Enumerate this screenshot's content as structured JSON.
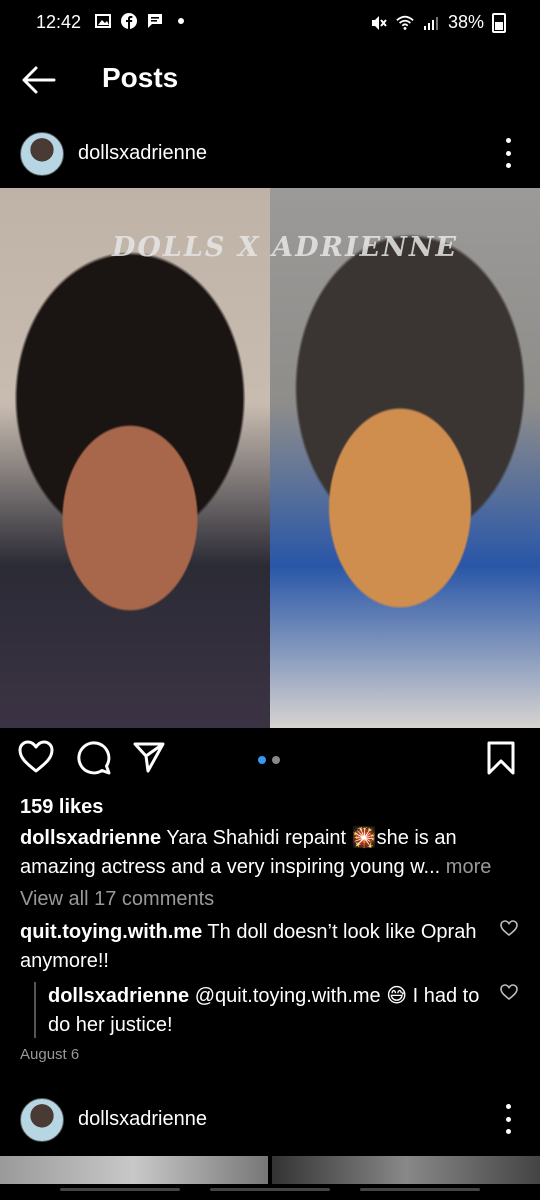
{
  "status": {
    "time": "12:42",
    "battery": "38%",
    "left_icons": [
      "gallery-icon",
      "facebook-icon",
      "message-icon",
      "dot-icon"
    ],
    "right_icons": [
      "mute-icon",
      "wifi-icon",
      "signal-icon",
      "battery-icon"
    ]
  },
  "header": {
    "title": "Posts"
  },
  "post": {
    "username": "dollsxadrienne",
    "watermark": "DOLLS X ADRIENNE",
    "likes": "159 likes",
    "caption_user": "dollsxadrienne",
    "caption_text": "Yara Shahidi repaint 🎇she is an amazing actress and a very inspiring young w...",
    "caption_more": "more",
    "view_comments": "View all 17 comments",
    "comment_user": "quit.toying.with.me",
    "comment_text": "Th doll doesn’t look like Oprah anymore!!",
    "reply_user": "dollsxadrienne",
    "reply_text": "@quit.toying.with.me 😅 I had to do her justice!",
    "date": "August 6",
    "carousel": {
      "count": 2,
      "active": 1
    }
  },
  "post2": {
    "username": "dollsxadrienne"
  },
  "colors": {
    "background": "#000000",
    "text": "#ffffff",
    "muted": "#999999",
    "accent": "#3897f0"
  }
}
